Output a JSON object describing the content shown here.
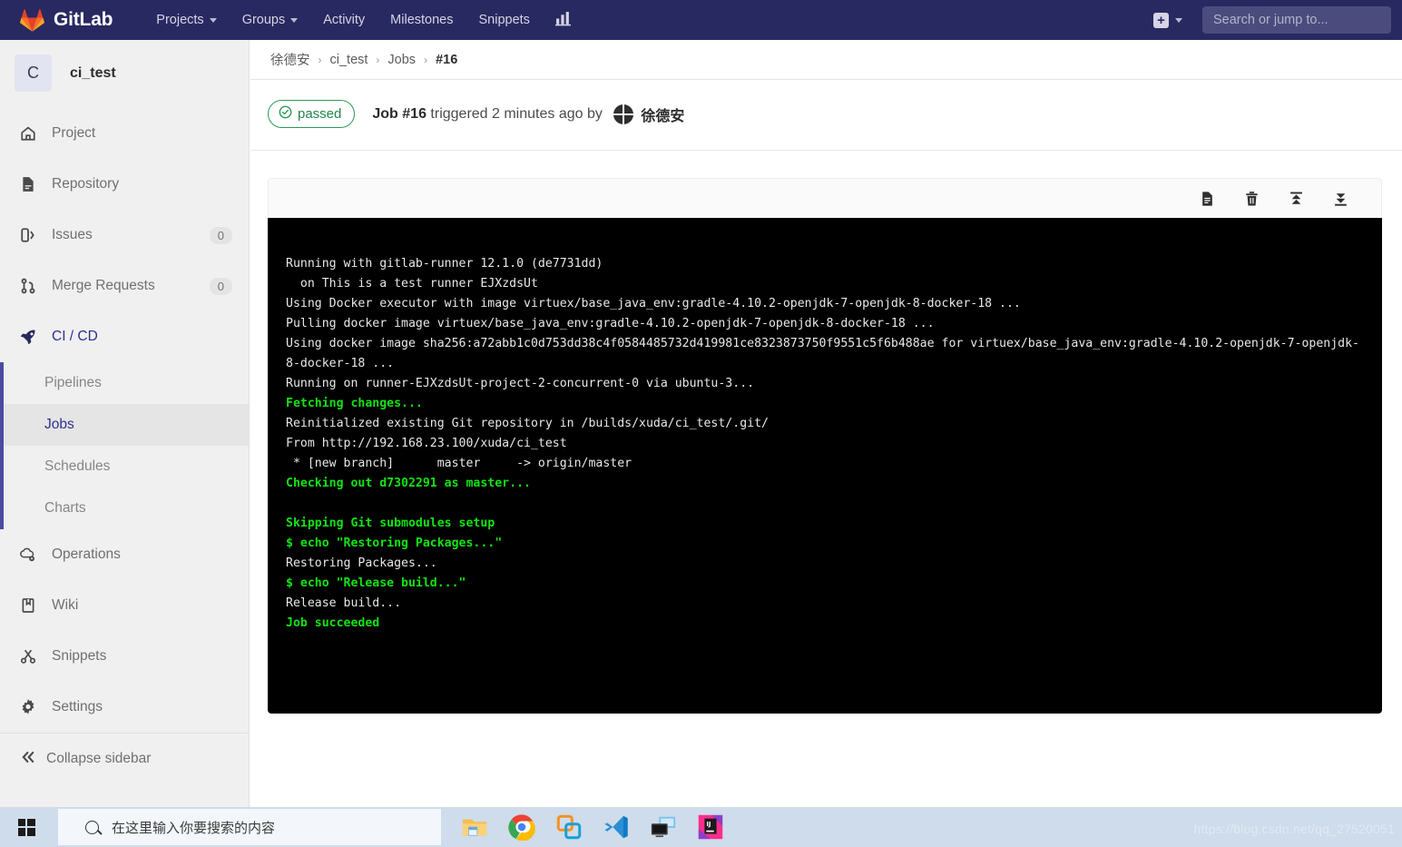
{
  "navbar": {
    "brand": "GitLab",
    "links": [
      {
        "label": "Projects",
        "has_caret": true
      },
      {
        "label": "Groups",
        "has_caret": true
      },
      {
        "label": "Activity",
        "has_caret": false
      },
      {
        "label": "Milestones",
        "has_caret": false
      },
      {
        "label": "Snippets",
        "has_caret": false
      }
    ],
    "chart_icon": "chart-icon",
    "plus_label": "+",
    "search_placeholder": "Search or jump to...",
    "search_value": "",
    "bg_color": "#292961"
  },
  "sidebar": {
    "project_initial": "C",
    "project_name": "ci_test",
    "items": [
      {
        "label": "Project",
        "icon": "home-icon",
        "count": ""
      },
      {
        "label": "Repository",
        "icon": "file-icon",
        "count": ""
      },
      {
        "label": "Issues",
        "icon": "issue-icon",
        "count": "0"
      },
      {
        "label": "Merge Requests",
        "icon": "merge-request-icon",
        "count": "0"
      },
      {
        "label": "CI / CD",
        "icon": "rocket-icon",
        "count": ""
      },
      {
        "label": "Operations",
        "icon": "operations-icon",
        "count": ""
      },
      {
        "label": "Wiki",
        "icon": "book-icon",
        "count": ""
      },
      {
        "label": "Snippets",
        "icon": "scissors-icon",
        "count": ""
      },
      {
        "label": "Settings",
        "icon": "gear-icon",
        "count": ""
      }
    ],
    "cicd_subitems": [
      {
        "label": "Pipelines",
        "active": false
      },
      {
        "label": "Jobs",
        "active": true
      },
      {
        "label": "Schedules",
        "active": false
      },
      {
        "label": "Charts",
        "active": false
      }
    ],
    "collapse_label": "Collapse sidebar",
    "collapse_icon": "double-chevron-left-icon",
    "active_accent": "#4b4ba3"
  },
  "breadcrumb": {
    "items": [
      "徐德安",
      "ci_test",
      "Jobs",
      "#16"
    ],
    "separator": "›"
  },
  "job": {
    "status_label": "passed",
    "status_icon": "check-circle-icon",
    "status_color": "#23864c",
    "title_strong": "Job #16",
    "title_rest": " triggered 2 minutes ago by ",
    "user_name": "徐德安",
    "user_avatar": "user-avatar"
  },
  "log_toolbar": {
    "buttons": [
      {
        "name": "raw-log-icon",
        "title": "Show complete raw"
      },
      {
        "name": "erase-job-log-icon",
        "title": "Erase job log"
      },
      {
        "name": "scroll-to-top-icon",
        "title": "Scroll to top"
      },
      {
        "name": "scroll-to-bottom-icon",
        "title": "Scroll to bottom"
      }
    ]
  },
  "log": {
    "lines": [
      {
        "text": "Running with gitlab-runner 12.1.0 (de7731dd)",
        "green": false
      },
      {
        "text": "  on This is a test runner EJXzdsUt",
        "green": false
      },
      {
        "text": "Using Docker executor with image virtuex/base_java_env:gradle-4.10.2-openjdk-7-openjdk-8-docker-18 ...",
        "green": false
      },
      {
        "text": "Pulling docker image virtuex/base_java_env:gradle-4.10.2-openjdk-7-openjdk-8-docker-18 ...",
        "green": false
      },
      {
        "text": "Using docker image sha256:a72abb1c0d753dd38c4f0584485732d419981ce8323873750f9551c5f6b488ae for virtuex/base_java_env:gradle-4.10.2-openjdk-7-openjdk-8-docker-18 ...",
        "green": false
      },
      {
        "text": "Running on runner-EJXzdsUt-project-2-concurrent-0 via ubuntu-3...",
        "green": false
      },
      {
        "text": "Fetching changes...",
        "green": true
      },
      {
        "text": "Reinitialized existing Git repository in /builds/xuda/ci_test/.git/",
        "green": false
      },
      {
        "text": "From http://192.168.23.100/xuda/ci_test",
        "green": false
      },
      {
        "text": " * [new branch]      master     -> origin/master",
        "green": false
      },
      {
        "text": "Checking out d7302291 as master...",
        "green": true
      },
      {
        "text": "",
        "green": false
      },
      {
        "text": "Skipping Git submodules setup",
        "green": true
      },
      {
        "text": "$ echo \"Restoring Packages...\"",
        "green": true
      },
      {
        "text": "Restoring Packages...",
        "green": false
      },
      {
        "text": "$ echo \"Release build...\"",
        "green": true
      },
      {
        "text": "Release build...",
        "green": false
      },
      {
        "text": "Job succeeded",
        "green": true
      }
    ],
    "text_color": "#e8e8e8",
    "green_color": "#12e312",
    "bg_color": "#000000"
  },
  "taskbar": {
    "start_icon": "windows-start-icon",
    "search_placeholder": "在这里输入你要搜索的内容",
    "search_icon": "search-icon",
    "apps": [
      {
        "name": "file-explorer-icon"
      },
      {
        "name": "google-chrome-icon"
      },
      {
        "name": "vmware-icon"
      },
      {
        "name": "vs-code-icon"
      },
      {
        "name": "remote-desktop-icon"
      },
      {
        "name": "intellij-idea-icon"
      }
    ]
  },
  "watermark": {
    "text": "https://blog.csdn.net/qq_27520051"
  }
}
